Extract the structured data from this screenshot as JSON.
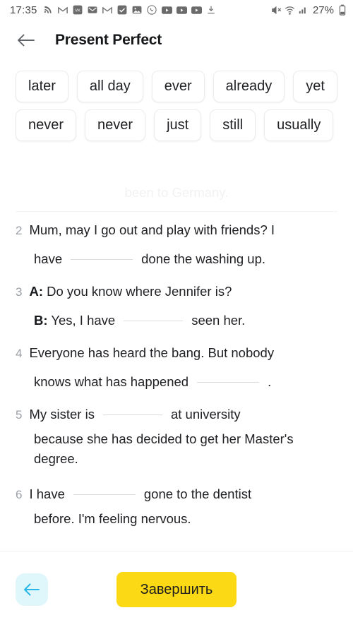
{
  "statusbar": {
    "time": "17:35",
    "battery_text": "27%",
    "left_icons": [
      "rss-icon",
      "gmail-icon",
      "vk-icon",
      "mail-icon",
      "gmail-icon",
      "checkbox-icon",
      "gallery-icon",
      "viber-icon",
      "youtube-icon",
      "youtube-icon",
      "youtube-icon",
      "download-icon"
    ],
    "right_icons": [
      "mute-icon",
      "wifi-icon",
      "signal-icon",
      "battery-icon"
    ]
  },
  "header": {
    "back_icon": "arrow-left-icon",
    "title": "Present Perfect"
  },
  "chips": [
    {
      "label": "later"
    },
    {
      "label": "all day"
    },
    {
      "label": "ever"
    },
    {
      "label": "already"
    },
    {
      "label": "yet"
    },
    {
      "label": "never"
    },
    {
      "label": "never"
    },
    {
      "label": "just"
    },
    {
      "label": "still"
    },
    {
      "label": "usually"
    }
  ],
  "ghost_text": "been to Germany.",
  "questions": [
    {
      "number": "2",
      "line1_pre": "Mum, may I go out and play with friends? I",
      "line2_pre": "have",
      "line2_post": "done the washing up."
    },
    {
      "number": "3",
      "speaker_a": "A:",
      "line1_pre": "Do you know where Jennifer is?",
      "speaker_b": "B:",
      "line2_pre": "Yes, I have",
      "line2_post": "seen her."
    },
    {
      "number": "4",
      "line1_pre": "Everyone has heard the bang. But nobody",
      "line2_pre": "knows what has happened",
      "line2_post": "."
    },
    {
      "number": "5",
      "line1_pre": "My sister is",
      "line1_post": "at university",
      "line2": "because she has decided to get her Master's degree."
    },
    {
      "number": "6",
      "line1_pre": "I have",
      "line1_post": "gone to the dentist",
      "line2": "before. I'm feeling nervous."
    }
  ],
  "bottombar": {
    "back_icon": "arrow-left-icon",
    "finish_label": "Завершить"
  },
  "colors": {
    "accent_yellow": "#fbd914",
    "back_button_bg": "#dff6fb",
    "back_button_arrow": "#29b6e8",
    "text_primary": "#202124",
    "number_gray": "#9aa0a6",
    "blank_line": "#dcdcdc"
  }
}
